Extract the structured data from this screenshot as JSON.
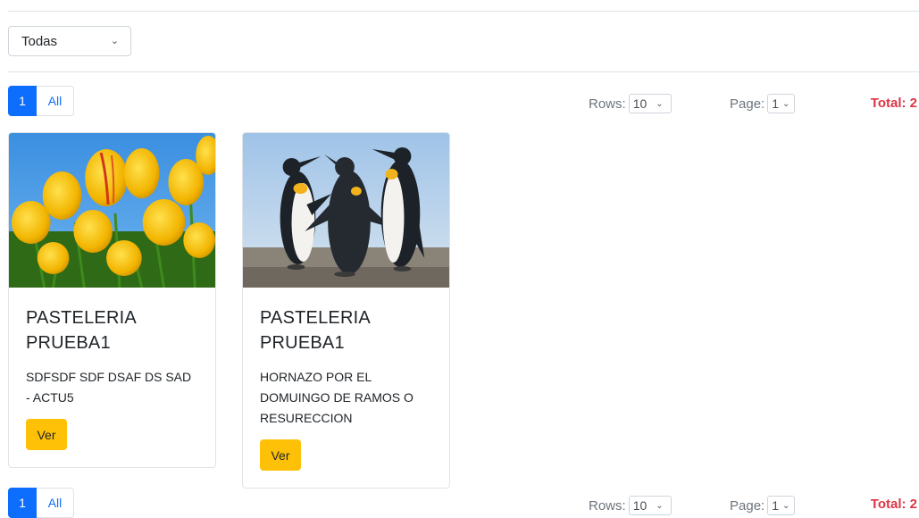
{
  "filter": {
    "selected": "Todas"
  },
  "pagination": {
    "page_label": "1",
    "all_label": "All"
  },
  "controls": {
    "rows_label": "Rows:",
    "rows_value": "10",
    "page_label": "Page:",
    "page_value": "1",
    "total_text": "Total: 2"
  },
  "cards": [
    {
      "title": "PASTELERIA PRUEBA1",
      "description": "SDFSDF SDF DSAF DS SAD - ACTU5",
      "button_label": "Ver"
    },
    {
      "title": "PASTELERIA PRUEBA1",
      "description": "HORNAZO POR EL DOMUINGO DE RAMOS O RESURECCION",
      "button_label": "Ver"
    }
  ],
  "colors": {
    "primary": "#0d6efd",
    "warning": "#ffc107",
    "danger": "#dc3545"
  }
}
